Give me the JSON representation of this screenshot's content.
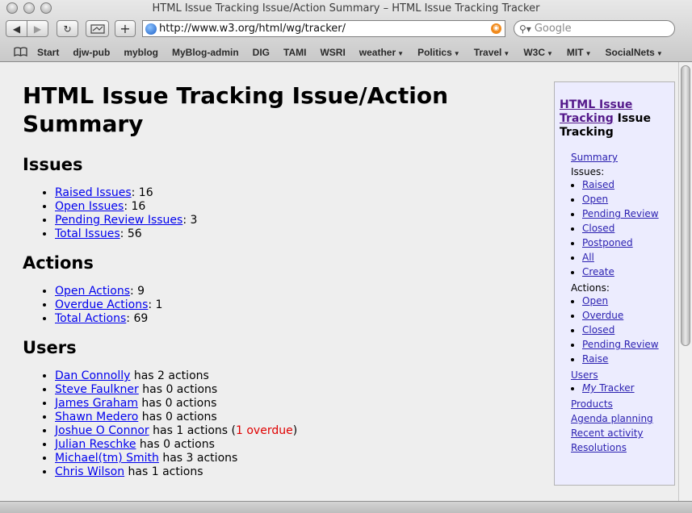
{
  "window": {
    "title": "HTML Issue Tracking Issue/Action Summary – HTML Issue Tracking Tracker"
  },
  "toolbar": {
    "back": "◀",
    "forward": "▶",
    "reload": "↻",
    "add": "+",
    "url": "http://www.w3.org/html/wg/tracker/",
    "search_placeholder": "Google"
  },
  "bookmarks": [
    {
      "label": "Start",
      "menu": false
    },
    {
      "label": "djw-pub",
      "menu": false
    },
    {
      "label": "myblog",
      "menu": false
    },
    {
      "label": "MyBlog-admin",
      "menu": false
    },
    {
      "label": "DIG",
      "menu": false
    },
    {
      "label": "TAMI",
      "menu": false
    },
    {
      "label": "WSRI",
      "menu": false
    },
    {
      "label": "weather",
      "menu": true
    },
    {
      "label": "Politics",
      "menu": true
    },
    {
      "label": "Travel",
      "menu": true
    },
    {
      "label": "W3C",
      "menu": true
    },
    {
      "label": "MIT",
      "menu": true
    },
    {
      "label": "SocialNets",
      "menu": true
    }
  ],
  "page": {
    "title": "HTML Issue Tracking Issue/Action Summary",
    "issues_heading": "Issues",
    "issues": [
      {
        "label": "Raised Issues",
        "value": ": 16"
      },
      {
        "label": "Open Issues",
        "value": ": 16"
      },
      {
        "label": "Pending Review Issues",
        "value": ": 3"
      },
      {
        "label": "Total Issues",
        "value": ": 56"
      }
    ],
    "actions_heading": "Actions",
    "actions": [
      {
        "label": "Open Actions",
        "value": ": 9"
      },
      {
        "label": "Overdue Actions",
        "value": ": 1"
      },
      {
        "label": "Total Actions",
        "value": ": 69"
      }
    ],
    "users_heading": "Users",
    "users": [
      {
        "name": "Dan Connolly",
        "text": " has 2 actions",
        "overdue": "",
        "tail": ""
      },
      {
        "name": "Steve Faulkner",
        "text": " has 0 actions",
        "overdue": "",
        "tail": ""
      },
      {
        "name": "James Graham",
        "text": " has 0 actions",
        "overdue": "",
        "tail": ""
      },
      {
        "name": "Shawn Medero",
        "text": " has 0 actions",
        "overdue": "",
        "tail": ""
      },
      {
        "name": "Joshue O Connor",
        "text": " has 1 actions (",
        "overdue": "1 overdue",
        "tail": ")"
      },
      {
        "name": "Julian Reschke",
        "text": " has 0 actions",
        "overdue": "",
        "tail": ""
      },
      {
        "name": "Michael(tm) Smith",
        "text": " has 3 actions",
        "overdue": "",
        "tail": ""
      },
      {
        "name": "Chris Wilson",
        "text": " has 1 actions",
        "overdue": "",
        "tail": ""
      }
    ]
  },
  "sidebar": {
    "title_link": "HTML Issue Tracking",
    "title_rest": " Issue Tracking",
    "summary": "Summary",
    "issues_label": "Issues:",
    "issue_links": [
      "Raised",
      "Open",
      "Pending Review",
      "Closed",
      "Postponed",
      "All",
      "Create"
    ],
    "actions_label": "Actions:",
    "action_links": [
      "Open",
      "Overdue",
      "Closed",
      "Pending Review",
      "Raise"
    ],
    "users": "Users",
    "my_tracker_em": "My",
    "my_tracker_rest": " Tracker",
    "products": "Products",
    "agenda": "Agenda planning",
    "recent": "Recent activity",
    "resolutions": "Resolutions"
  }
}
